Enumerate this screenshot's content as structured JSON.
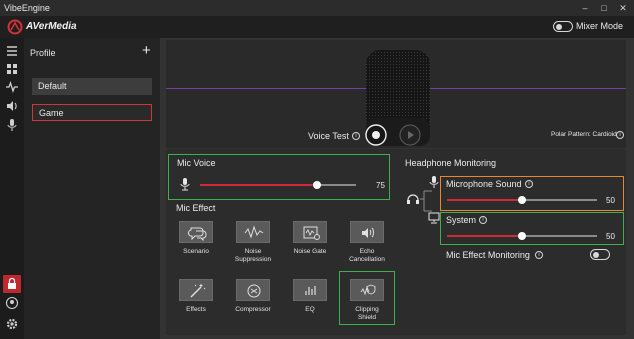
{
  "window": {
    "title": "VibeEngine",
    "minimize": "–",
    "maximize": "□",
    "close": "✕"
  },
  "brand": {
    "name": "AVerMedia",
    "mixer_mode_label": "Mixer Mode",
    "mixer_mode_on": false
  },
  "rail": {
    "icons": [
      "menu-icon",
      "dashboard-icon",
      "waveform-icon",
      "speaker-icon",
      "mic-settings-icon"
    ],
    "bottom_icons": [
      "lock-icon",
      "account-icon",
      "gear-icon"
    ]
  },
  "profile": {
    "title": "Profile",
    "add": "+",
    "items": [
      {
        "label": "Default"
      },
      {
        "label": "Game"
      }
    ]
  },
  "preview": {
    "voice_test_label": "Voice Test",
    "info": "i",
    "polar_pattern": "Polar Pattern: Cardioid"
  },
  "mic_voice": {
    "label": "Mic Voice",
    "value": "75",
    "level": 0.75
  },
  "mic_effect": {
    "label": "Mic Effect",
    "effects": [
      {
        "label": "Scenario"
      },
      {
        "label": "Noise\nSuppression"
      },
      {
        "label": "Noise Gate"
      },
      {
        "label": "Echo\nCancellation"
      },
      {
        "label": "Effects"
      },
      {
        "label": "Compressor"
      },
      {
        "label": "EQ"
      },
      {
        "label": "Clipping\nShield"
      }
    ]
  },
  "headphone": {
    "label": "Headphone Monitoring",
    "microphone_sound": {
      "label": "Microphone Sound",
      "value": "50",
      "level": 0.5
    },
    "system": {
      "label": "System",
      "value": "50",
      "level": 0.5
    },
    "mic_effect_monitoring": {
      "label": "Mic Effect Monitoring",
      "on": false
    }
  },
  "colors": {
    "accent": "#cf2a36",
    "highlight_green": "#3fae4f",
    "highlight_orange": "#e48a2c",
    "purple_line": "#7a3ba8"
  }
}
